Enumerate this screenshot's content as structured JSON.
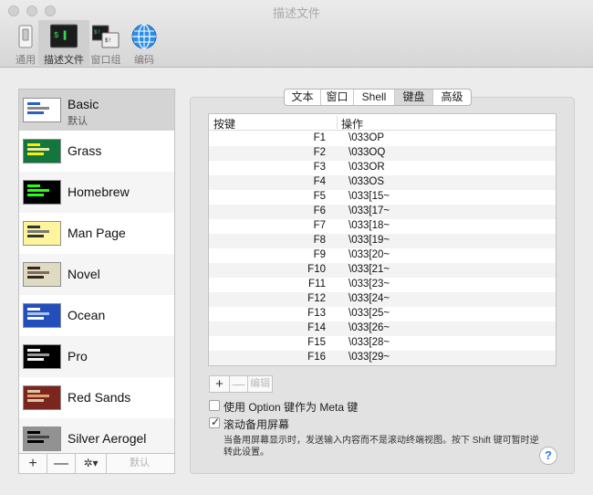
{
  "window": {
    "title": "描述文件"
  },
  "toolbar": {
    "items": [
      {
        "label": "通用",
        "icon": "switch-icon"
      },
      {
        "label": "描述文件",
        "icon": "terminal-icon"
      },
      {
        "label": "窗口组",
        "icon": "window-groups-icon"
      },
      {
        "label": "编码",
        "icon": "globe-icon"
      }
    ],
    "selected": "描述文件"
  },
  "profiles": {
    "items": [
      {
        "name": "Basic",
        "subtitle": "默认",
        "bg": "#ffffff",
        "fg": "#2a60c0"
      },
      {
        "name": "Grass",
        "subtitle": "",
        "bg": "#13773d",
        "fg": "#ffee00"
      },
      {
        "name": "Homebrew",
        "subtitle": "",
        "bg": "#000000",
        "fg": "#28fe14"
      },
      {
        "name": "Man Page",
        "subtitle": "",
        "bg": "#fef49c",
        "fg": "#333333"
      },
      {
        "name": "Novel",
        "subtitle": "",
        "bg": "#dfdbc3",
        "fg": "#3b2322"
      },
      {
        "name": "Ocean",
        "subtitle": "",
        "bg": "#224fbc",
        "fg": "#ffffff"
      },
      {
        "name": "Pro",
        "subtitle": "",
        "bg": "#000000",
        "fg": "#f2f2f2"
      },
      {
        "name": "Red Sands",
        "subtitle": "",
        "bg": "#7a251e",
        "fg": "#d7c9a7"
      },
      {
        "name": "Silver Aerogel",
        "subtitle": "",
        "bg": "#929292",
        "fg": "#000000"
      }
    ],
    "selected": "Basic",
    "buttons": {
      "add": "+",
      "remove": "—",
      "gear": "✲▾",
      "default": "默认"
    }
  },
  "tabs": {
    "items": [
      "文本",
      "窗口",
      "Shell",
      "键盘",
      "高级"
    ],
    "active": "键盘"
  },
  "keyboard": {
    "columns": {
      "key": "按键",
      "action": "操作"
    },
    "rows": [
      {
        "key": "F1",
        "action": "\\033OP"
      },
      {
        "key": "F2",
        "action": "\\033OQ"
      },
      {
        "key": "F3",
        "action": "\\033OR"
      },
      {
        "key": "F4",
        "action": "\\033OS"
      },
      {
        "key": "F5",
        "action": "\\033[15~"
      },
      {
        "key": "F6",
        "action": "\\033[17~"
      },
      {
        "key": "F7",
        "action": "\\033[18~"
      },
      {
        "key": "F8",
        "action": "\\033[19~"
      },
      {
        "key": "F9",
        "action": "\\033[20~"
      },
      {
        "key": "F10",
        "action": "\\033[21~"
      },
      {
        "key": "F11",
        "action": "\\033[23~"
      },
      {
        "key": "F12",
        "action": "\\033[24~"
      },
      {
        "key": "F13",
        "action": "\\033[25~"
      },
      {
        "key": "F14",
        "action": "\\033[26~"
      },
      {
        "key": "F15",
        "action": "\\033[28~"
      },
      {
        "key": "F16",
        "action": "\\033[29~"
      }
    ],
    "buttons": {
      "add": "+",
      "remove": "—",
      "edit": "编辑"
    },
    "options": {
      "meta": {
        "label": "使用 Option 键作为 Meta 键",
        "checked": false
      },
      "alt_screen": {
        "label": "滚动备用屏幕",
        "checked": true
      }
    },
    "note": "当备用屏幕显示时，发送输入内容而不是滚动终端视图。按下 Shift 键可暂时逆转此设置。",
    "help": "?"
  }
}
